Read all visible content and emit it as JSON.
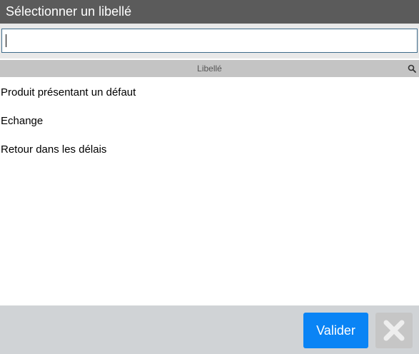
{
  "dialog": {
    "title": "Sélectionner un libellé"
  },
  "search": {
    "value": "",
    "placeholder": ""
  },
  "table": {
    "column_header": "Libellé",
    "header_icon": "search-icon",
    "rows": [
      "Produit présentant un défaut",
      "Echange",
      "Retour dans les délais"
    ]
  },
  "footer": {
    "validate_label": "Valider",
    "close_icon": "close-icon"
  },
  "colors": {
    "titlebar": "#5b5b5b",
    "accent": "#0a84f5",
    "header_band": "#c4c4c4",
    "footer": "#d0d3d6",
    "close_button": "#c6c6c6"
  }
}
